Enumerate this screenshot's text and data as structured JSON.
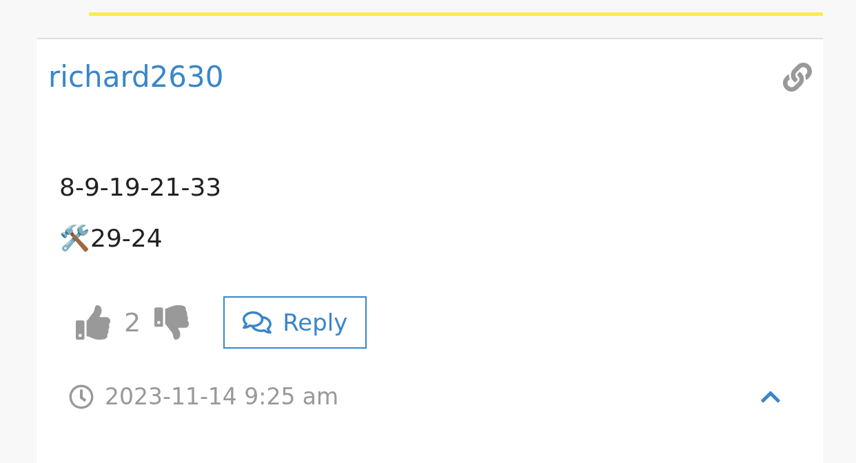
{
  "author": "richard2630",
  "lines": [
    "8-9-19-21-33",
    "🛠️29-24"
  ],
  "votes": {
    "up_count": "2"
  },
  "reply_button": "Reply",
  "timestamp": "2023-11-14 9:25 am"
}
